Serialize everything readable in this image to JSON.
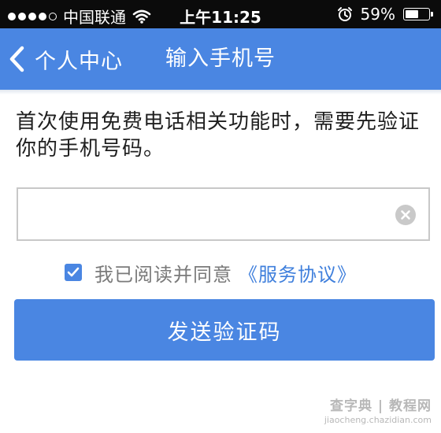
{
  "status_bar": {
    "carrier": "中国联通",
    "time": "上午11:25",
    "battery_percent": "59%",
    "battery_level": 0.59,
    "icons": [
      "signal-dots",
      "wifi-icon",
      "alarm-icon",
      "battery-icon"
    ]
  },
  "nav": {
    "back_label": "个人中心",
    "title": "输入手机号",
    "back_icon": "chevron-left-icon"
  },
  "description": "首次使用免费电话相关功能时，需要先验证你的手机号码。",
  "phone_input": {
    "value": "",
    "placeholder": "",
    "clear_icon": "clear-circle-icon"
  },
  "agreement": {
    "checked": true,
    "text": "我已阅读并同意",
    "link": "《服务协议》"
  },
  "send_button": {
    "label": "发送验证码"
  },
  "watermark": {
    "main": "查字典 | 教程网",
    "sub": "jiaocheng.chazidian.com"
  },
  "colors": {
    "accent": "#4a86e2",
    "link": "#3f7fdc",
    "status_bar_bg": "#0b0b0b",
    "text_primary": "#1f1f1f",
    "text_secondary": "#7a7a7a"
  }
}
